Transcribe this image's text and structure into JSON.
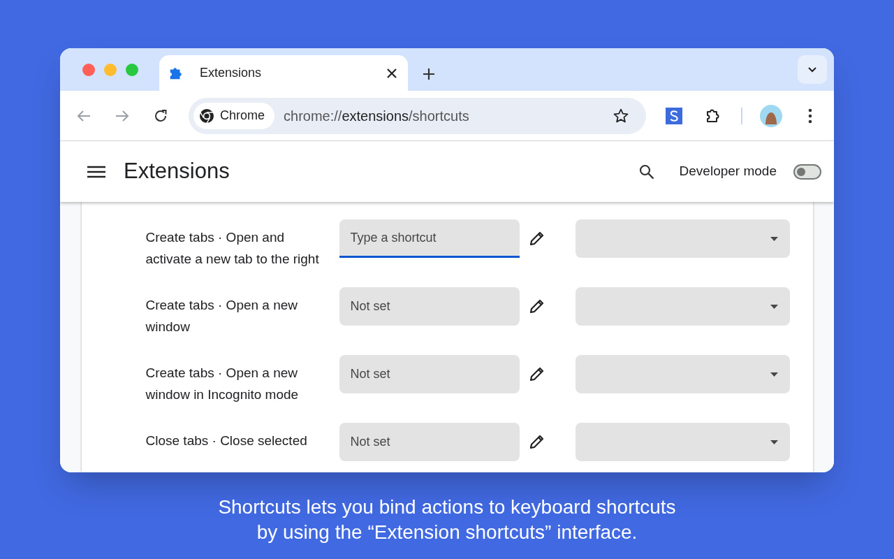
{
  "browser": {
    "tabs": [
      {
        "title": "Extensions",
        "selected": true
      }
    ],
    "chip": "Chrome",
    "url": {
      "scheme": "chrome://",
      "host": "extensions",
      "path": "/shortcuts"
    }
  },
  "header": {
    "title": "Extensions",
    "developer_mode": {
      "label": "Developer mode",
      "on": false
    }
  },
  "shortcuts": [
    {
      "label": "Create tabs · Open and activate a new tab to the right",
      "placeholder": "Type a shortcut",
      "focused": true
    },
    {
      "label": "Create tabs · Open a new window",
      "placeholder": "Not set",
      "focused": false
    },
    {
      "label": "Create tabs · Open a new window in Incognito mode",
      "placeholder": "Not set",
      "focused": false
    },
    {
      "label": "Close tabs · Close selected",
      "placeholder": "Not set",
      "focused": false
    }
  ],
  "caption": [
    "Shortcuts lets you bind actions to keyboard shortcuts",
    "by using the “Extension shortcuts” interface."
  ]
}
